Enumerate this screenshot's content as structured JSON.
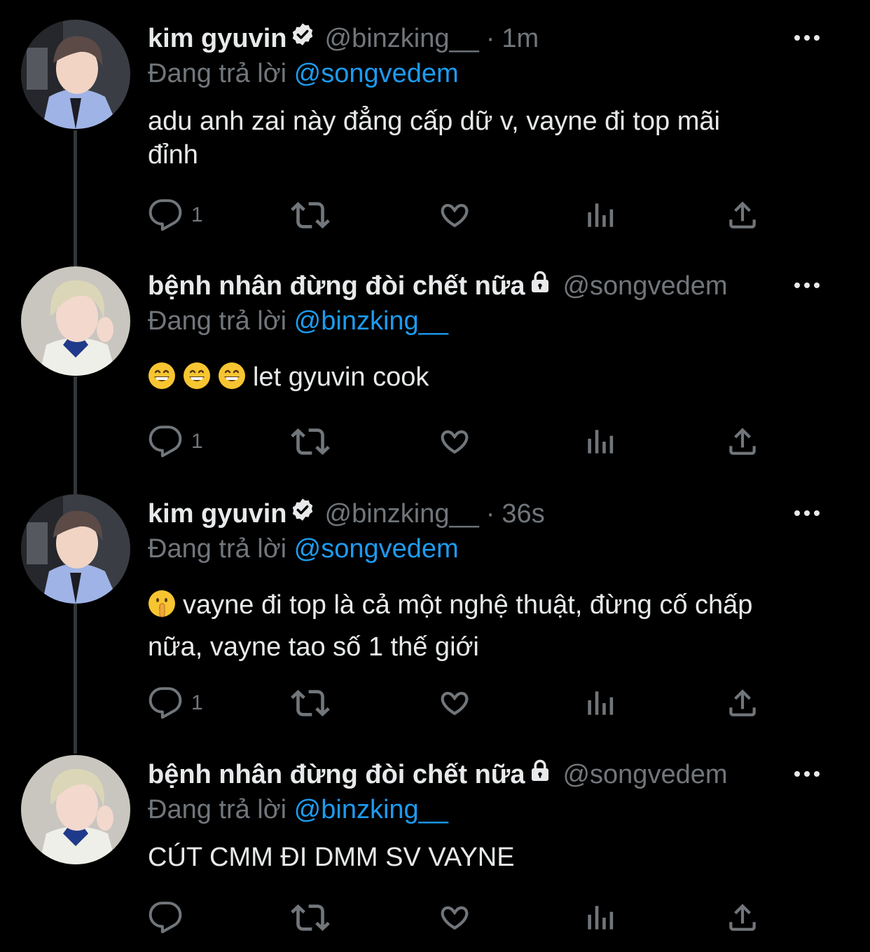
{
  "theme": {
    "background": "#000000",
    "text": "#e7e9ea",
    "secondary": "#71767b",
    "accent": "#1d9bf0"
  },
  "tweets": [
    {
      "display_name": "kim gyuvin",
      "badge": "verified-icon",
      "handle": "@binzking__",
      "time": "1m",
      "reply_prefix": "Đang trả lời",
      "reply_mention": "@songvedem",
      "text_lines": [
        "adu anh zai này đẳng cấp dữ v, vayne đi top mãi",
        "đỉnh"
      ],
      "emojis": [],
      "reply_count": "1"
    },
    {
      "display_name": "bệnh nhân đừng đòi chết nữa",
      "badge": "lock-icon",
      "handle": "@songvedem",
      "time": "",
      "reply_prefix": "Đang trả lời",
      "reply_mention": "@binzking__",
      "text_lines": [
        "let gyuvin cook"
      ],
      "emojis": [
        "grinning-face",
        "grinning-face",
        "grinning-face"
      ],
      "reply_count": "1"
    },
    {
      "display_name": "kim gyuvin",
      "badge": "verified-icon",
      "handle": "@binzking__",
      "time": "36s",
      "reply_prefix": "Đang trả lời",
      "reply_mention": "@songvedem",
      "text_lines": [
        "vayne đi top là cả một nghệ thuật, đừng cố chấp",
        "nữa, vayne tao số 1 thế giới"
      ],
      "emojis": [
        "shushing-face"
      ],
      "reply_count": "1"
    },
    {
      "display_name": "bệnh nhân đừng đòi chết nữa",
      "badge": "lock-icon",
      "handle": "@songvedem",
      "time": "",
      "reply_prefix": "Đang trả lời",
      "reply_mention": "@binzking__",
      "text_lines": [
        "CÚT CMM ĐI DMM SV VAYNE"
      ],
      "emojis": [],
      "reply_count": ""
    }
  ]
}
